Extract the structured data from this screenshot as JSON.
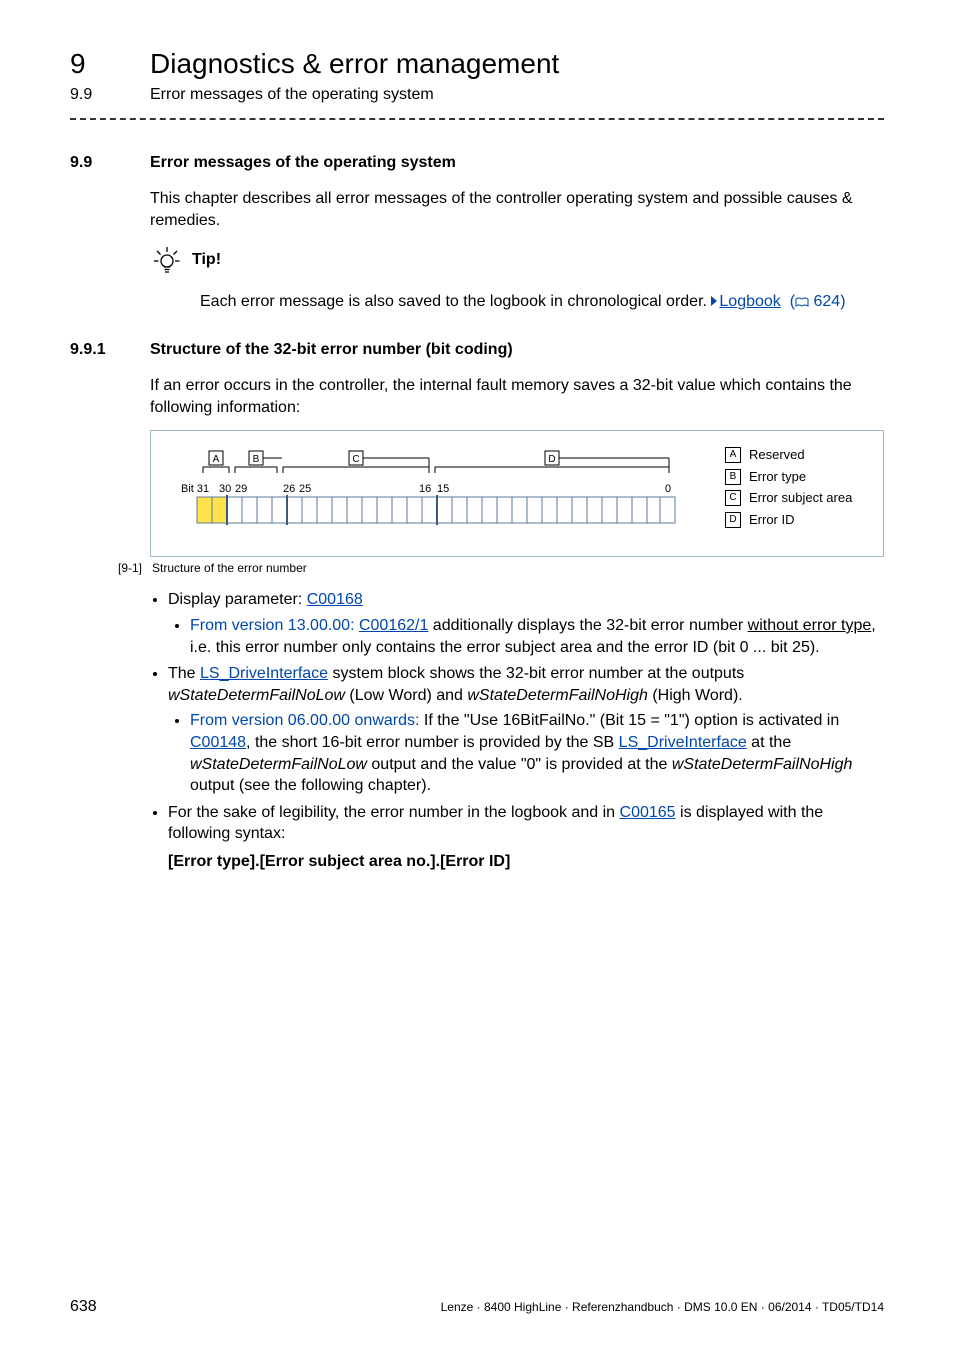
{
  "header": {
    "chapter_number": "9",
    "chapter_title": "Diagnostics & error management",
    "section_number": "9.9",
    "section_title": "Error messages of the operating system"
  },
  "s99": {
    "num": "9.9",
    "title": "Error messages of the operating system",
    "intro": "This chapter describes all error messages of the controller operating system and possible causes & remedies.",
    "tip_label": "Tip!",
    "tip_text_pre": "Each error message is also saved to the logbook in chronological order.  ",
    "tip_link": "Logbook",
    "tip_pageref": "624"
  },
  "s991": {
    "num": "9.9.1",
    "title": "Structure of the 32-bit error number (bit coding)",
    "intro": "If an error occurs in the controller, the internal fault memory saves a 32-bit value which contains the following information:",
    "legend": {
      "A": "Reserved",
      "B": "Error type",
      "C": "Error subject area",
      "D": "Error ID"
    },
    "caption_num": "[9-1]",
    "caption_text": "Structure of the error number",
    "fig": {
      "labels": {
        "A": "A",
        "B": "B",
        "C": "C",
        "D": "D"
      },
      "bits": {
        "b31": "Bit 31",
        "b30": "30",
        "b29": "29",
        "b26": "26",
        "b25": "25",
        "b16": "16",
        "b15": "15",
        "b0": "0"
      }
    },
    "bullets": {
      "b1_pre": "Display parameter: ",
      "b1_link": "C00168",
      "b1_sub1_colored": "From version 13.00.00: ",
      "b1_sub1_link": "C00162/1",
      "b1_sub1_mid": " additionally displays the 32-bit error number ",
      "b1_sub1_ul": "without error type",
      "b1_sub1_post": ", i.e. this error number only contains the error subject area and the error ID (bit 0 ... bit 25).",
      "b2_pre": "The ",
      "b2_link": "LS_DriveInterface",
      "b2_mid1": " system block shows the 32-bit error number at the outputs ",
      "b2_i1": "wStateDetermFailNoLow",
      "b2_mid2": " (Low Word) and ",
      "b2_i2": "wStateDetermFailNoHigh",
      "b2_post": " (High Word).",
      "b2_sub1_colored": "From version 06.00.00 onwards:",
      "b2_sub1_text1": " If the \"Use 16BitFailNo.\" (Bit 15 = \"1\") option is activated in ",
      "b2_sub1_linkA": "C00148",
      "b2_sub1_text2": ", the short 16-bit error number is provided by the SB ",
      "b2_sub1_linkB": "LS_DriveInterface",
      "b2_sub1_text3": " at the ",
      "b2_sub1_i1": "wStateDetermFailNoLow",
      "b2_sub1_text4": " output and the value \"0\" is provided at the ",
      "b2_sub1_i2": "wStateDetermFailNoHigh",
      "b2_sub1_text5": " output (see the following chapter).",
      "b3_pre": "For the sake of legibility, the error number in the logbook and in ",
      "b3_link": "C00165",
      "b3_post": " is displayed with the following syntax:",
      "b3_syntax": "[Error type].[Error subject area no.].[Error ID]"
    }
  },
  "footer": {
    "page": "638",
    "doc": "Lenze · 8400 HighLine · Referenzhandbuch · DMS 10.0 EN · 06/2014 · TD05/TD14"
  }
}
